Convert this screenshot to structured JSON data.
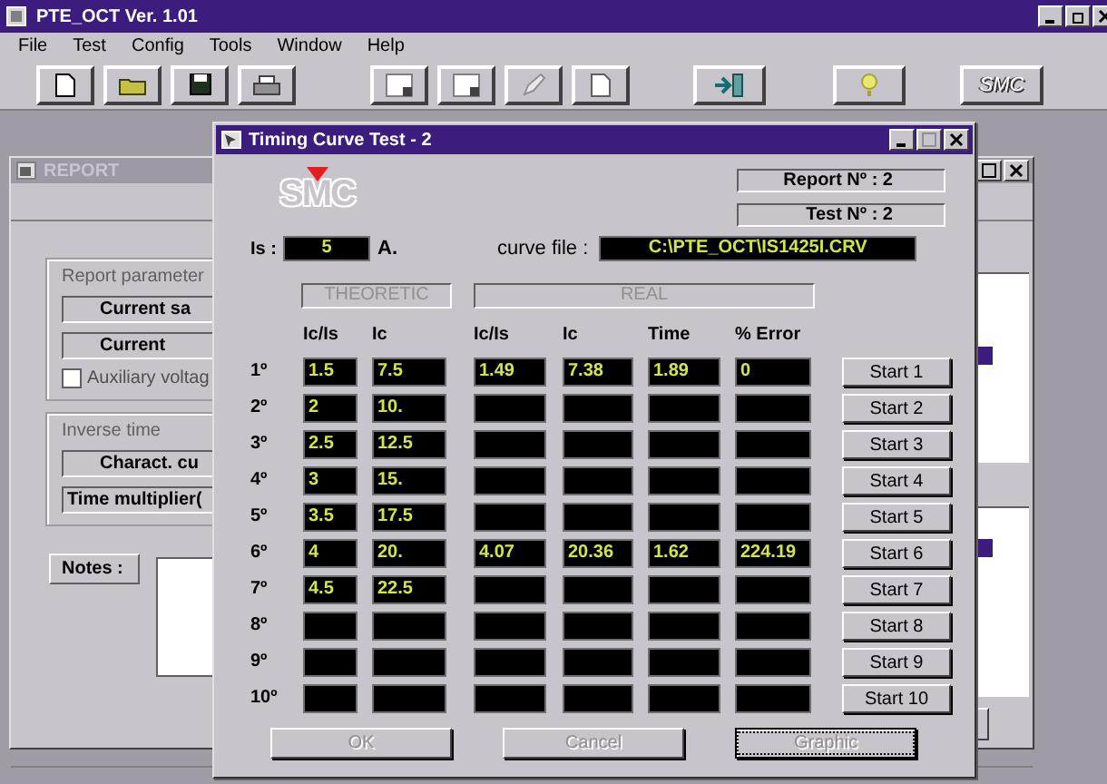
{
  "app": {
    "title": "PTE_OCT  Ver. 1.01"
  },
  "menu": [
    "File",
    "Test",
    "Config",
    "Tools",
    "Window",
    "Help"
  ],
  "toolbar": {
    "logo": "SMC"
  },
  "report": {
    "title": "REPORT",
    "params_group": "Report parameter",
    "fields": [
      "Current sa",
      "Current"
    ],
    "aux_checkbox": {
      "label": "Auxiliary voltag",
      "checked": false
    },
    "inverse_group": "Inverse time",
    "inverse_fields": [
      "Charact. cu",
      "Time multiplier("
    ],
    "notes_label": "Notes :"
  },
  "dialog": {
    "title": "Timing Curve Test - 2",
    "logo": "SMC",
    "report_no": "Report Nº : 2",
    "test_no": "Test Nº : 2",
    "is_label": "Is :",
    "is_value": "5",
    "is_unit": "A.",
    "curve_label": "curve file :",
    "curve_file": "C:\\PTE_OCT\\IS1425I.CRV",
    "sections": [
      "THEORETIC",
      "REAL"
    ],
    "columns": [
      "Ic/Is",
      "Ic",
      "Ic/Is",
      "Ic",
      "Time",
      "% Error"
    ],
    "rows": [
      {
        "label": "1º",
        "theoretic": [
          "1.5",
          "7.5"
        ],
        "real": [
          "1.49",
          "7.38",
          "1.89",
          "0"
        ],
        "button": "Start 1"
      },
      {
        "label": "2º",
        "theoretic": [
          "2",
          "10."
        ],
        "button": "Start 2"
      },
      {
        "label": "3º",
        "theoretic": [
          "2.5",
          "12.5"
        ],
        "button": "Start 3"
      },
      {
        "label": "4º",
        "theoretic": [
          "3",
          "15."
        ],
        "button": "Start 4"
      },
      {
        "label": "5º",
        "theoretic": [
          "3.5",
          "17.5"
        ],
        "button": "Start 5"
      },
      {
        "label": "6º",
        "theoretic": [
          "4",
          "20."
        ],
        "real": [
          "4.07",
          "20.36",
          "1.62",
          "224.19"
        ],
        "button": "Start 6"
      },
      {
        "label": "7º",
        "theoretic": [
          "4.5",
          "22.5"
        ],
        "button": "Start 7"
      },
      {
        "label": "8º",
        "button": "Start 8"
      },
      {
        "label": "9º",
        "button": "Start 9"
      },
      {
        "label": "10º",
        "button": "Start 10"
      }
    ],
    "buttons": [
      {
        "label": "OK",
        "disabled": true,
        "focused": false
      },
      {
        "label": "Cancel",
        "disabled": true,
        "focused": false
      },
      {
        "label": "Graphic",
        "disabled": true,
        "focused": true
      }
    ]
  }
}
